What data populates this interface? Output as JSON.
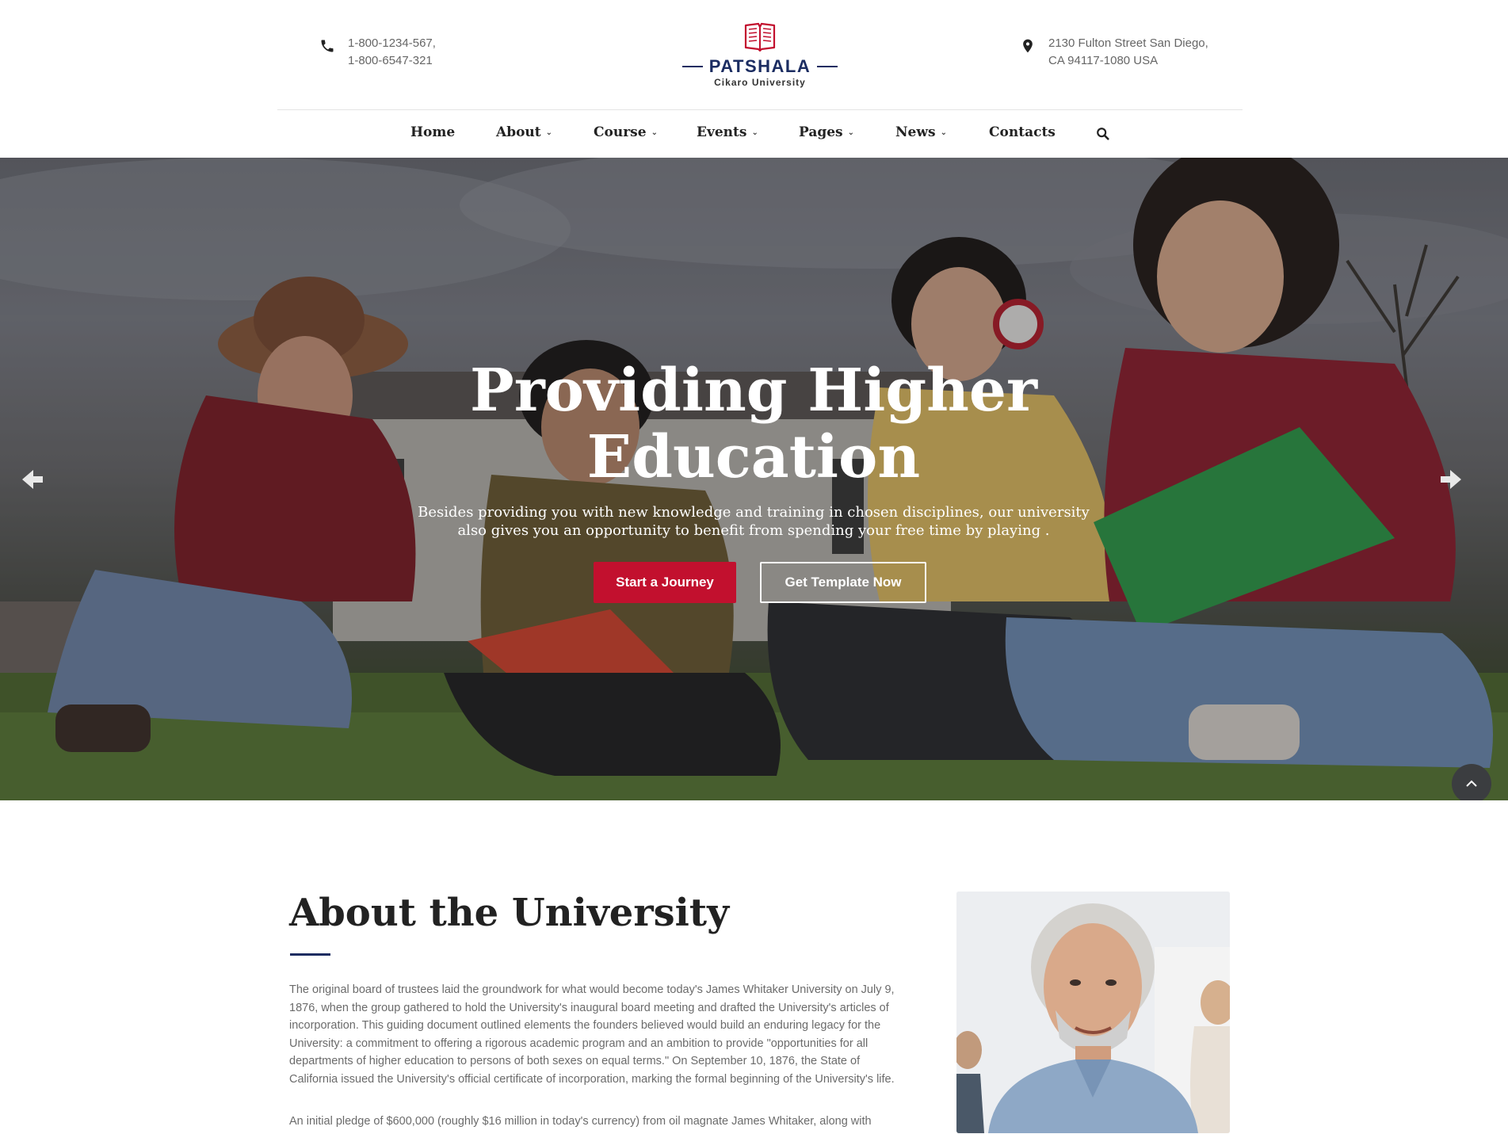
{
  "header": {
    "phone_lines": [
      "1-800-1234-567,",
      "1-800-6547-321"
    ],
    "address_lines": [
      "2130 Fulton Street San Diego,",
      "CA 94117-1080 USA"
    ],
    "logo": {
      "title": "PATSHALA",
      "subtitle": "Cikaro University",
      "brand_color": "#1b2c61",
      "accent_color": "#c2102e"
    }
  },
  "nav": {
    "items": [
      {
        "label": "Home",
        "has_dropdown": false
      },
      {
        "label": "About",
        "has_dropdown": true
      },
      {
        "label": "Course",
        "has_dropdown": true
      },
      {
        "label": "Events",
        "has_dropdown": true
      },
      {
        "label": "Pages",
        "has_dropdown": true
      },
      {
        "label": "News",
        "has_dropdown": true
      },
      {
        "label": "Contacts",
        "has_dropdown": false
      }
    ],
    "dropdown_icon": "chevron-down-icon",
    "search_icon": "search-icon"
  },
  "hero": {
    "title_line1": "Providing Higher",
    "title_line2": "Education",
    "description_line1": "Besides providing you with new knowledge and training in chosen disciplines, our university",
    "description_line2": "also gives you an opportunity to benefit from spending your free time by playing .",
    "primary_button": "Start a Journey",
    "secondary_button": "Get Template Now",
    "prev_icon": "arrow-left-icon",
    "next_icon": "arrow-right-icon",
    "scroll_top_icon": "chevron-up-icon"
  },
  "about": {
    "title": "About the University",
    "paragraph1": "The original board of trustees laid the groundwork for what would become today's James Whitaker University on July 9, 1876, when the group gathered to hold the University's inaugural board meeting and drafted the University's articles of incorporation. This guiding document outlined elements the founders believed would build an enduring legacy for the University: a commitment to offering a rigorous academic program and an ambition to provide \"opportunities for all departments of higher education to persons of both sexes on equal terms.\" On September 10, 1876, the State of California issued the University's official certificate of incorporation, marking the formal beginning of the University's life.",
    "paragraph2": "An initial pledge of $600,000 (roughly $16 million in today's currency) from oil magnate James Whitaker, along with"
  }
}
